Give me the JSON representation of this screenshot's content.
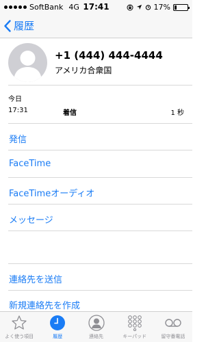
{
  "status_bar": {
    "carrier": "SoftBank",
    "network": "4G",
    "time": "17:41",
    "battery": "17%",
    "battery_level": 0.17
  },
  "nav": {
    "back_label": "履歴"
  },
  "contact": {
    "phone": "+1 (444) 444-4444",
    "region": "アメリカ合衆国"
  },
  "history": {
    "date": "今日",
    "time": "17:31",
    "type": "着信",
    "duration": "1 秒"
  },
  "actions": {
    "call": "発信",
    "facetime": "FaceTime",
    "facetime_audio": "FaceTimeオーディオ",
    "message": "メッセージ",
    "share_contact": "連絡先を送信",
    "new_contact": "新規連絡先を作成"
  },
  "tabs": [
    {
      "label": "よく使う項目",
      "icon": "star-icon"
    },
    {
      "label": "履歴",
      "icon": "clock-icon"
    },
    {
      "label": "連絡先",
      "icon": "person-icon"
    },
    {
      "label": "キーパッド",
      "icon": "keypad-icon"
    },
    {
      "label": "留守番電話",
      "icon": "voicemail-icon"
    }
  ],
  "colors": {
    "accent": "#1a7cf5",
    "inactive": "#8e8e93"
  }
}
